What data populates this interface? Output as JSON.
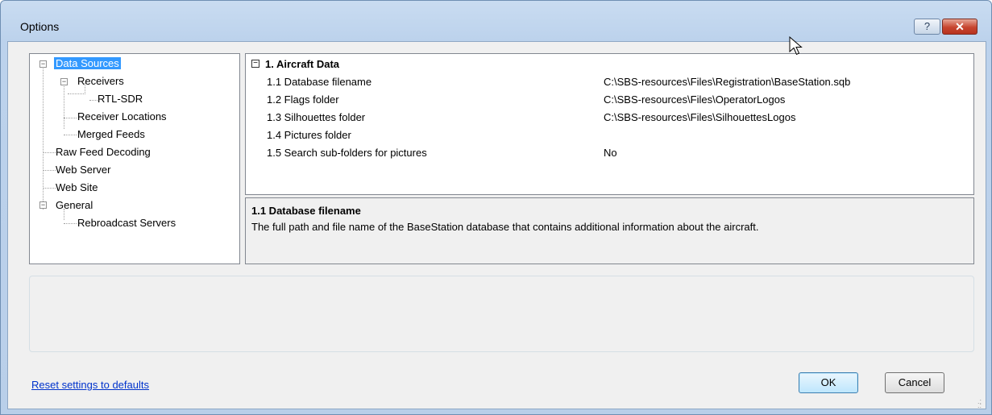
{
  "window": {
    "title": "Options",
    "help_label": "?",
    "close_label": "✕"
  },
  "tree": {
    "items": [
      {
        "label": "Data Sources",
        "selected": true
      },
      {
        "label": "Receivers"
      },
      {
        "label": "RTL-SDR"
      },
      {
        "label": "Receiver Locations"
      },
      {
        "label": "Merged Feeds"
      },
      {
        "label": "Raw Feed Decoding"
      },
      {
        "label": "Web Server"
      },
      {
        "label": "Web Site"
      },
      {
        "label": "General"
      },
      {
        "label": "Rebroadcast Servers"
      }
    ],
    "expander_symbol": "−"
  },
  "grid": {
    "category": "1. Aircraft Data",
    "category_expander": "−",
    "properties": [
      {
        "name": "1.1 Database filename",
        "value": "C:\\SBS-resources\\Files\\Registration\\BaseStation.sqb"
      },
      {
        "name": "1.2 Flags folder",
        "value": "C:\\SBS-resources\\Files\\OperatorLogos"
      },
      {
        "name": "1.3 Silhouettes folder",
        "value": "C:\\SBS-resources\\Files\\SilhouettesLogos"
      },
      {
        "name": "1.4 Pictures folder",
        "value": ""
      },
      {
        "name": "1.5 Search sub-folders for pictures",
        "value": "No"
      }
    ]
  },
  "description": {
    "title": "1.1 Database filename",
    "text": "The full path and file name of the BaseStation database that contains additional information about the aircraft."
  },
  "footer": {
    "reset_link": "Reset settings to defaults",
    "ok_label": "OK",
    "cancel_label": "Cancel"
  },
  "colors": {
    "selection": "#3399ff",
    "link": "#0033cc",
    "close_button": "#c7452f"
  }
}
